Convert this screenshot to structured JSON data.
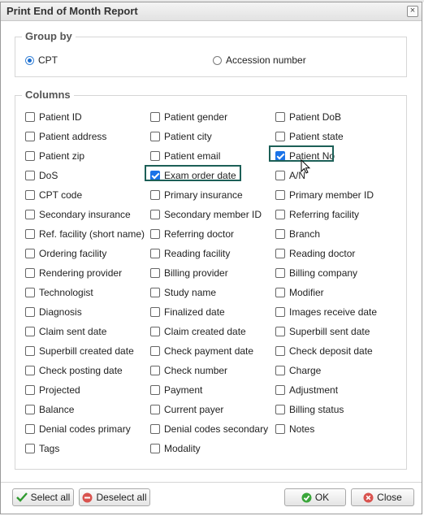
{
  "dialog": {
    "title": "Print End of Month Report",
    "close_label": "×"
  },
  "group_by": {
    "legend": "Group by",
    "options": [
      {
        "label": "CPT",
        "selected": true
      },
      {
        "label": "Accession number",
        "selected": false
      }
    ]
  },
  "columns": {
    "legend": "Columns",
    "col1": [
      {
        "label": "Patient ID",
        "checked": false
      },
      {
        "label": "Patient address",
        "checked": false
      },
      {
        "label": "Patient zip",
        "checked": false
      },
      {
        "label": "DoS",
        "checked": false
      },
      {
        "label": "CPT code",
        "checked": false
      },
      {
        "label": "Secondary insurance",
        "checked": false
      },
      {
        "label": "Ref. facility (short name)",
        "checked": false
      },
      {
        "label": "Ordering facility",
        "checked": false
      },
      {
        "label": "Rendering provider",
        "checked": false
      },
      {
        "label": "Technologist",
        "checked": false
      },
      {
        "label": "Diagnosis",
        "checked": false
      },
      {
        "label": "Claim sent date",
        "checked": false
      },
      {
        "label": "Superbill created date",
        "checked": false
      },
      {
        "label": "Check posting date",
        "checked": false
      },
      {
        "label": "Projected",
        "checked": false
      },
      {
        "label": "Balance",
        "checked": false
      },
      {
        "label": "Denial codes primary",
        "checked": false
      },
      {
        "label": "Tags",
        "checked": false
      }
    ],
    "col2": [
      {
        "label": "Patient gender",
        "checked": false
      },
      {
        "label": "Patient city",
        "checked": false
      },
      {
        "label": "Patient email",
        "checked": false
      },
      {
        "label": "Exam order date",
        "checked": true
      },
      {
        "label": "Primary insurance",
        "checked": false
      },
      {
        "label": "Secondary member ID",
        "checked": false
      },
      {
        "label": "Referring doctor",
        "checked": false
      },
      {
        "label": "Reading facility",
        "checked": false
      },
      {
        "label": "Billing provider",
        "checked": false
      },
      {
        "label": "Study name",
        "checked": false
      },
      {
        "label": "Finalized date",
        "checked": false
      },
      {
        "label": "Claim created date",
        "checked": false
      },
      {
        "label": "Check payment date",
        "checked": false
      },
      {
        "label": "Check number",
        "checked": false
      },
      {
        "label": "Payment",
        "checked": false
      },
      {
        "label": "Current payer",
        "checked": false
      },
      {
        "label": "Denial codes secondary",
        "checked": false
      },
      {
        "label": "Modality",
        "checked": false
      }
    ],
    "col3": [
      {
        "label": "Patient DoB",
        "checked": false
      },
      {
        "label": "Patient state",
        "checked": false
      },
      {
        "label": "Patient No",
        "checked": true
      },
      {
        "label": "A/N",
        "checked": false
      },
      {
        "label": "Primary member ID",
        "checked": false
      },
      {
        "label": "Referring facility",
        "checked": false
      },
      {
        "label": "Branch",
        "checked": false
      },
      {
        "label": "Reading doctor",
        "checked": false
      },
      {
        "label": "Billing company",
        "checked": false
      },
      {
        "label": "Modifier",
        "checked": false
      },
      {
        "label": "Images receive date",
        "checked": false
      },
      {
        "label": "Superbill sent date",
        "checked": false
      },
      {
        "label": "Check deposit date",
        "checked": false
      },
      {
        "label": "Charge",
        "checked": false
      },
      {
        "label": "Adjustment",
        "checked": false
      },
      {
        "label": "Billing status",
        "checked": false
      },
      {
        "label": "Notes",
        "checked": false
      }
    ]
  },
  "footer": {
    "select_all": "Select all",
    "deselect_all": "Deselect all",
    "ok": "OK",
    "close": "Close"
  },
  "colors": {
    "accent": "#1a73e8",
    "highlight": "#1c5f57",
    "ok_green": "#3aa63a",
    "close_red": "#d9534f"
  }
}
